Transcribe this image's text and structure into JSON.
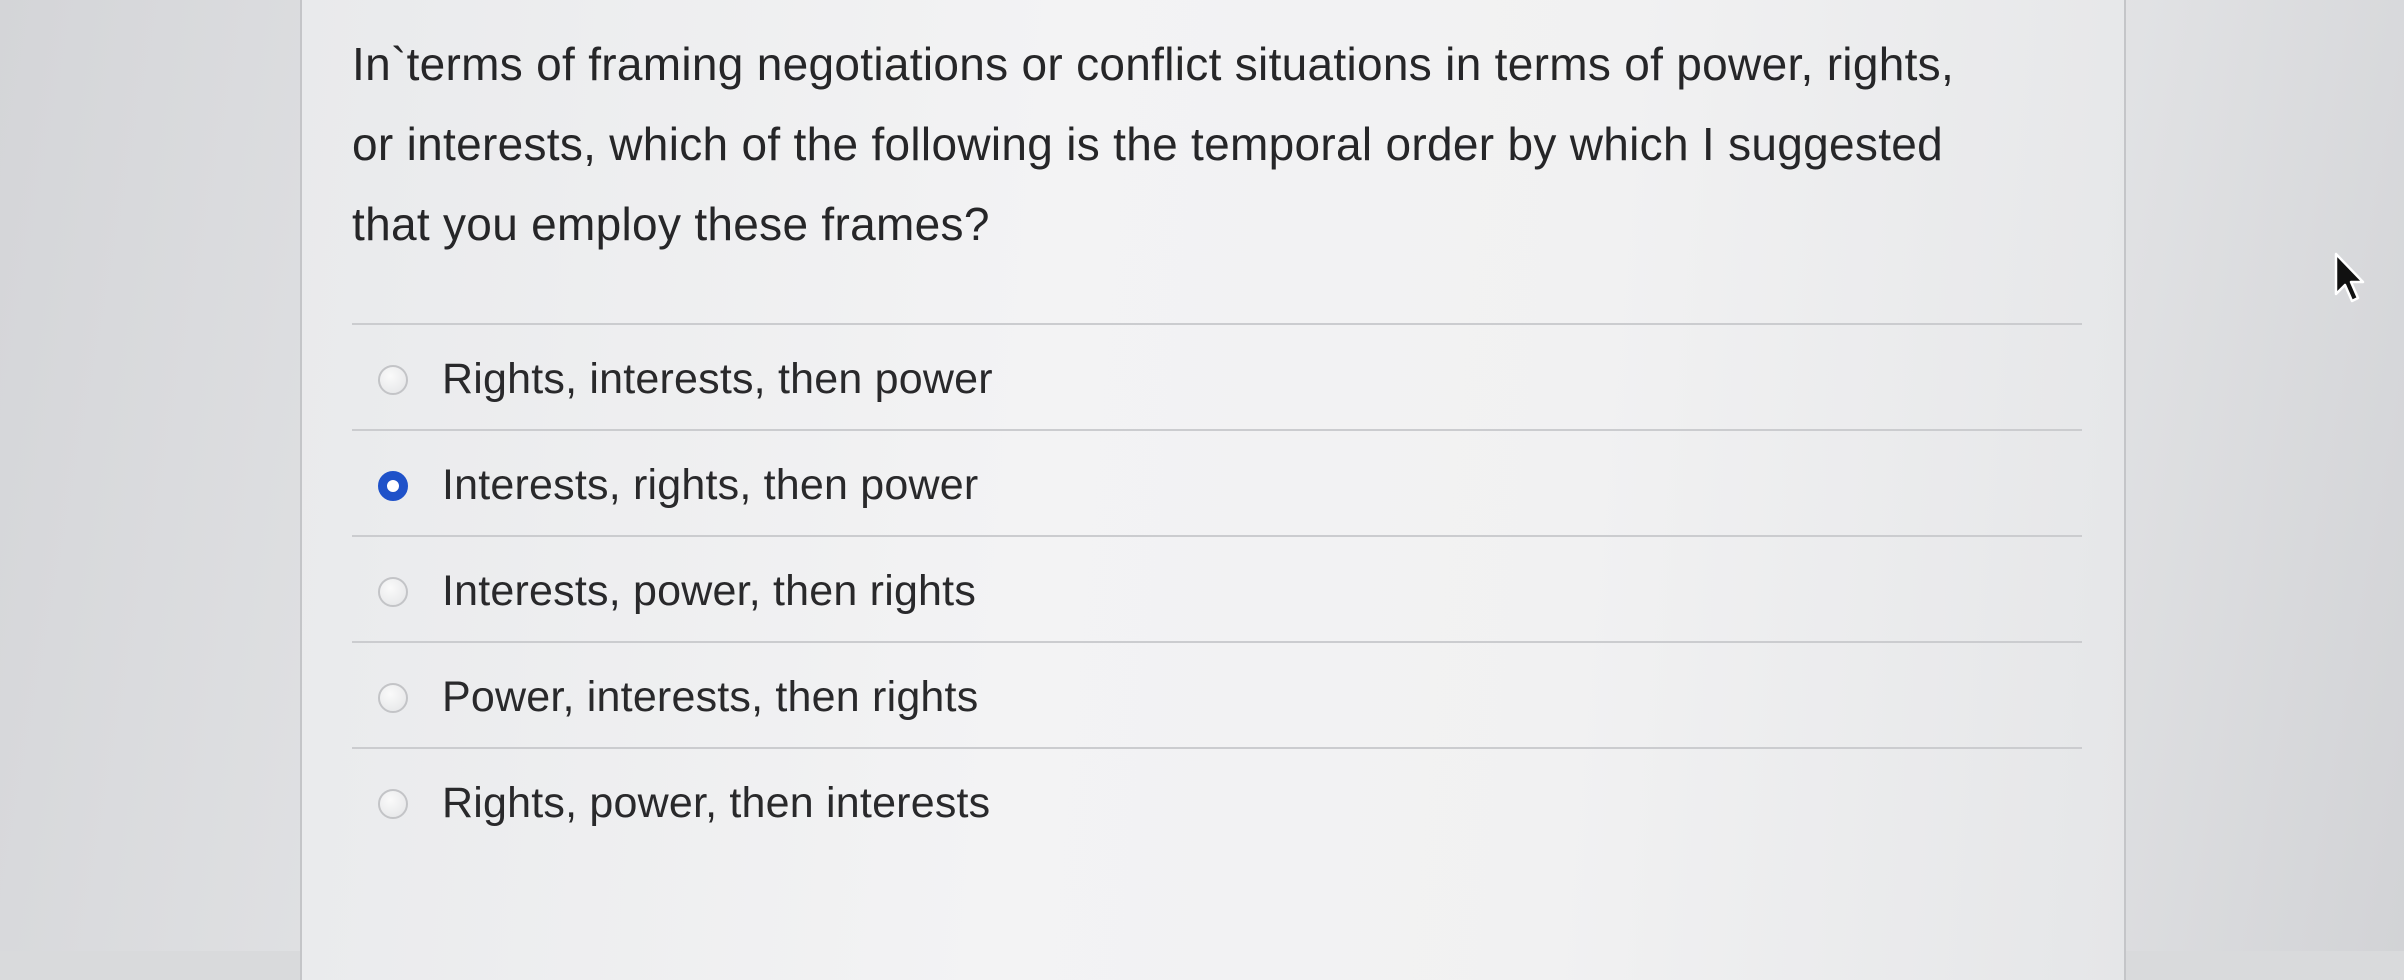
{
  "question": {
    "text": "In`terms of framing negotiations or conflict situations in terms of power, rights, or interests, which of the following is the temporal order by which I suggested that you employ these frames?"
  },
  "answers": [
    {
      "label": "Rights, interests, then power",
      "selected": false
    },
    {
      "label": "Interests, rights, then power",
      "selected": true
    },
    {
      "label": "Interests, power, then rights",
      "selected": false
    },
    {
      "label": "Power, interests, then rights",
      "selected": false
    },
    {
      "label": "Rights, power, then interests",
      "selected": false
    }
  ],
  "colors": {
    "selected_radio": "#1f52c9",
    "text": "#262628",
    "divider": "#cbcccf"
  },
  "icons": {
    "cursor": "mouse-pointer-icon"
  }
}
